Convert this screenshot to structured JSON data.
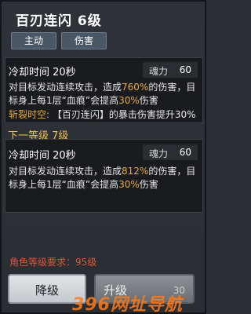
{
  "skill": {
    "title": "百刃连闪 6级",
    "tags": [
      "主动",
      "伤害"
    ]
  },
  "current": {
    "cooldown": "冷却时间 20秒",
    "mana_label": "魂力",
    "mana_value": "60",
    "desc_pre": "对目标发动连续攻击，造成",
    "desc_pct": "760%",
    "desc_mid": "的伤害，目标身上每1层“血痕”会提高",
    "desc_bonus": "30%",
    "desc_post": "伤害",
    "split_label": "斩裂时空:",
    "split_text": "【百刃连闪】的暴击伤害提升30%"
  },
  "next_level_label": "下一等级 7级",
  "next": {
    "cooldown": "冷却时间 20秒",
    "mana_label": "魂力",
    "mana_value": "60",
    "desc_pre": "对目标发动连续攻击，造成",
    "desc_pct": "812%",
    "desc_mid": "的伤害，目标身上每1层“血痕”会提高",
    "desc_bonus": "30%",
    "desc_post": "伤害"
  },
  "requirement": "角色等级要求：95级",
  "buttons": {
    "downgrade": "降级",
    "upgrade": "升级",
    "upgrade_cost": "30"
  },
  "watermark": "396网址导航"
}
